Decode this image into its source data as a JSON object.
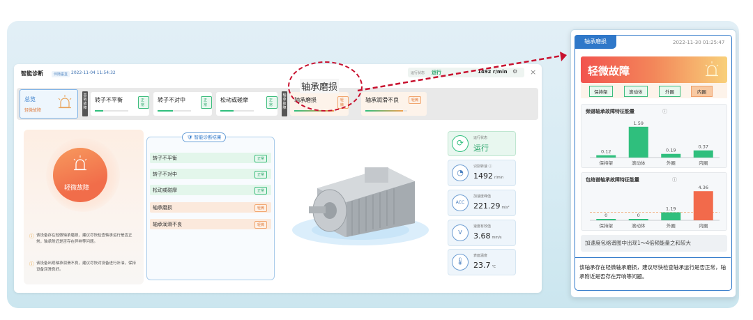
{
  "main": {
    "title": "智能诊断",
    "device_label": "伴随垂直",
    "timestamp": "2022-11-04 11:54:32",
    "run_label": "运行状态",
    "run_value": "运行",
    "speed_label": "识别转速",
    "speed_value": "1492 r/min",
    "close_icon": "×"
  },
  "overview": {
    "title": "总览",
    "status": "轻微故障"
  },
  "group_labels": {
    "basic": "基础故障",
    "bearing": "轴承故障"
  },
  "cards": [
    {
      "name": "转子不平衡",
      "badge": "正常",
      "level": 0.25
    },
    {
      "name": "转子不对中",
      "badge": "正常",
      "level": 0.45
    },
    {
      "name": "松动或碰摩",
      "badge": "正常",
      "level": 0.4
    },
    {
      "name": "轴承磨损",
      "badge": "轻微",
      "level": 0.95
    },
    {
      "name": "轴承润滑不良",
      "badge": "轻微",
      "level": 0.9
    }
  ],
  "status_card": {
    "level": "轻微故障",
    "notes": [
      "该设备存在轻微轴承磨损，建议尽快检查轴承运行是否正常，轴承附近是否存在异响等问题。",
      "该设备出现轴承润滑不良，建议尽快对设备进行补油，保持设备润滑良好。"
    ]
  },
  "results": {
    "title": "智能诊断结果",
    "rows": [
      {
        "name": "转子不平衡",
        "badge": "正常"
      },
      {
        "name": "转子不对中",
        "badge": "正常"
      },
      {
        "name": "松动或碰摩",
        "badge": "正常"
      },
      {
        "name": "轴承磨损",
        "badge": "轻微"
      },
      {
        "name": "轴承润滑不良",
        "badge": "轻微"
      }
    ]
  },
  "metrics": [
    {
      "label": "运行状态",
      "value": "运行",
      "unit": "",
      "icon": "refresh-icon",
      "glyph": "⟳"
    },
    {
      "label": "识别转速 ⓘ",
      "value": "1492",
      "unit": "r/min",
      "icon": "gauge-icon",
      "glyph": "◔"
    },
    {
      "label": "加速度峰值",
      "value": "221.29",
      "unit": "m/s²",
      "icon": "acc-icon",
      "glyph": "ACC"
    },
    {
      "label": "速度有效值",
      "value": "3.68",
      "unit": "mm/s",
      "icon": "velocity-icon",
      "glyph": "V"
    },
    {
      "label": "表面温度",
      "value": "23.7",
      "unit": "℃",
      "icon": "thermometer-icon",
      "glyph": "🌡"
    }
  ],
  "callout": {
    "text": "轴承磨损"
  },
  "side": {
    "tab": "轴承磨损",
    "timestamp": "2022-11-30 01:25:47",
    "level": "轻微故障",
    "parts": [
      "保持架",
      "滚动体",
      "外圈",
      "内圈"
    ],
    "chart1_title": "频谱轴承故障特征能量",
    "chart2_title": "包络谱轴承故障特征能量",
    "info": "加速度包络谱图中出现1～4倍频能量之和较大",
    "footer": "该轴承存在轻微轴承磨损，建议尽快检查轴承运行是否正常，轴承附近是否存在异响等问题。"
  },
  "chart_data": [
    {
      "type": "bar",
      "title": "频谱轴承故障特征能量",
      "categories": [
        "保持架",
        "滚动体",
        "外圈",
        "内圈"
      ],
      "values": [
        0.12,
        1.59,
        0.19,
        0.37
      ],
      "ylim": [
        0,
        1.8
      ]
    },
    {
      "type": "bar",
      "title": "包络谱轴承故障特征能量",
      "categories": [
        "保持架",
        "滚动体",
        "外圈",
        "内圈"
      ],
      "values": [
        0,
        0,
        1.19,
        4.36
      ],
      "ylim": [
        0,
        4.8
      ],
      "reference_line": 1.19
    }
  ],
  "colors": {
    "accent": "#2f78c9",
    "ok": "#2fbf7d",
    "warn": "#f08c4a",
    "danger": "#c8102e"
  }
}
